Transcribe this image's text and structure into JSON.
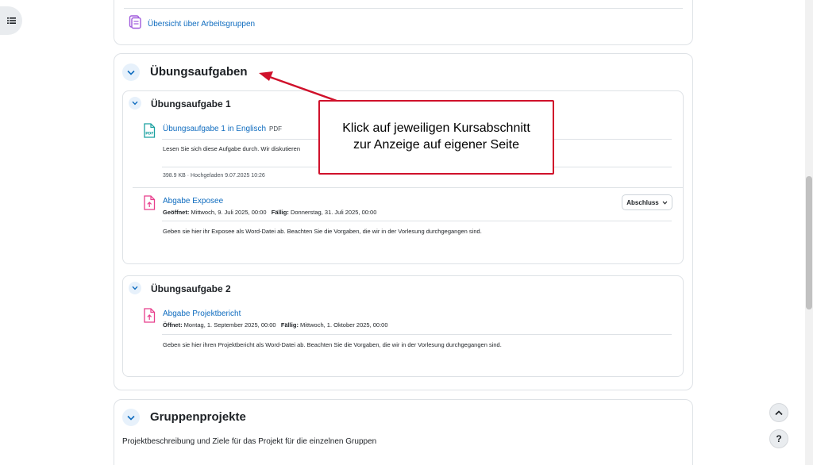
{
  "top_section": {
    "link_text": "Übersicht über Arbeitsgruppen"
  },
  "section_uebungsaufgaben": {
    "title": "Übungsaufgaben",
    "subsections": [
      {
        "title": "Übungsaufgabe 1",
        "resource": {
          "link_text": "Übungsaufgabe 1 in Englisch",
          "type_badge": "PDF",
          "description": "Lesen Sie sich diese Aufgabe durch. Wir diskutieren",
          "meta": "398.9 KB · Hochgeladen 9.07.2025 10:26"
        },
        "assignment": {
          "link_text": "Abgabe Exposee",
          "opened_label": "Geöffnet:",
          "opened_value": "Mittwoch, 9. Juli 2025, 00:00",
          "due_label": "Fällig:",
          "due_value": "Donnerstag, 31. Juli 2025, 00:00",
          "description": "Geben sie hier ihr Exposee als Word-Datei ab. Beachten Sie die Vorgaben, die wir in der Vorlesung durchgegangen sind.",
          "completion_button": "Abschluss"
        }
      },
      {
        "title": "Übungsaufgabe 2",
        "assignment": {
          "link_text": "Abgabe Projektbericht",
          "opened_label": "Öffnet:",
          "opened_value": "Montag, 1. September 2025, 00:00",
          "due_label": "Fällig:",
          "due_value": "Mittwoch, 1. Oktober 2025, 00:00",
          "description": "Geben sie hier ihren Projektbericht als Word-Datei ab. Beachten Sie die Vorgaben, die wir in der Vorlesung durchgegangen sind."
        }
      }
    ]
  },
  "section_gruppenprojekte": {
    "title": "Gruppenprojekte",
    "summary": "Projektbeschreibung und Ziele für das Projekt für die einzelnen Gruppen"
  },
  "callout": {
    "line1": "Klick auf jeweiligen Kursabschnitt",
    "line2": "zur Anzeige auf eigener Seite"
  },
  "floating_buttons": {
    "help_label": "?"
  },
  "colors": {
    "link": "#0f6cbf",
    "toggle_bg": "#e7f1fb",
    "callout_border": "#d0112b",
    "pdf_icon": "#1aa0a0",
    "assign_icon": "#e83e8c",
    "group_icon": "#a05adc"
  },
  "icons": {
    "drawer": "list-icon",
    "group_overview": "group-overview-icon",
    "pdf": "pdf-file-icon",
    "assignment": "assignment-upload-icon",
    "collapse": "chevron-down-icon",
    "back_to_top": "chevron-up-icon",
    "help": "question-mark-icon"
  }
}
